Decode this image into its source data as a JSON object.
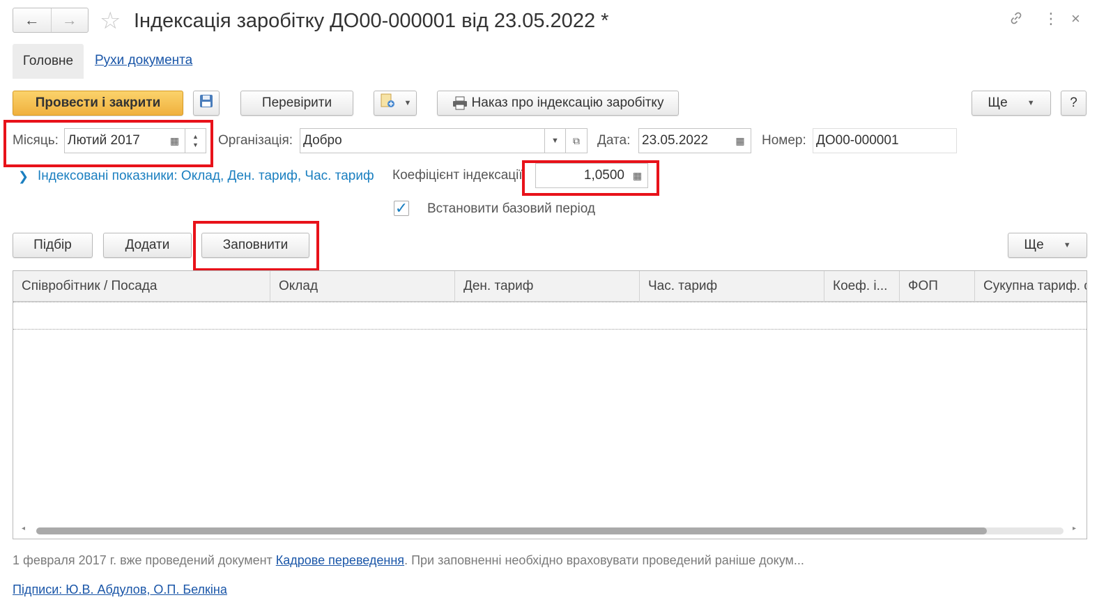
{
  "window": {
    "title": "Індексація заробітку ДО00-000001 від 23.05.2022 *",
    "back_icon": "←",
    "forward_icon": "→",
    "star_icon": "☆",
    "link_icon": "🔗",
    "more_icon": "⋮",
    "close_icon": "×"
  },
  "tabs": {
    "main": "Головне",
    "movements": "Рухи документа"
  },
  "toolbar": {
    "post_close": "Провести і закрити",
    "check": "Перевірити",
    "order_print": "Наказ про індексацію заробітку",
    "more": "Ще",
    "help": "?"
  },
  "fields": {
    "month_label": "Місяць:",
    "month_value": "Лютий 2017",
    "org_label": "Організація:",
    "org_value": "Добро",
    "date_label": "Дата:",
    "date_value": "23.05.2022",
    "number_label": "Номер:",
    "number_value": "ДО00-000001",
    "indexed_link": "Індексовані показники: Оклад, Ден. тариф, Час. тариф",
    "coef_label": "Коефіцієнт індексації:",
    "coef_value": "1,0500",
    "base_period_label": "Встановити базовий період",
    "base_period_checked": true
  },
  "table_toolbar": {
    "pick": "Підбір",
    "add": "Додати",
    "fill": "Заповнити",
    "more": "Ще"
  },
  "table": {
    "columns": [
      "Співробітник / Посада",
      "Оклад",
      "Ден. тариф",
      "Час. тариф",
      "Коеф. і...",
      "ФОП",
      "Сукупна тариф. с"
    ],
    "rows": []
  },
  "footer": {
    "notice_prefix": "1 февраля 2017 г. вже проведений документ ",
    "notice_link": "Кадрове переведення",
    "notice_suffix": ". При заповненні необхідно враховувати проведений раніше докум...",
    "signatures": "Підписи: Ю.В. Абдулов, О.П. Белкіна"
  },
  "colors": {
    "accent_button": "#f0b13e",
    "highlight_frame": "#e8121a",
    "link": "#1a56a8"
  }
}
